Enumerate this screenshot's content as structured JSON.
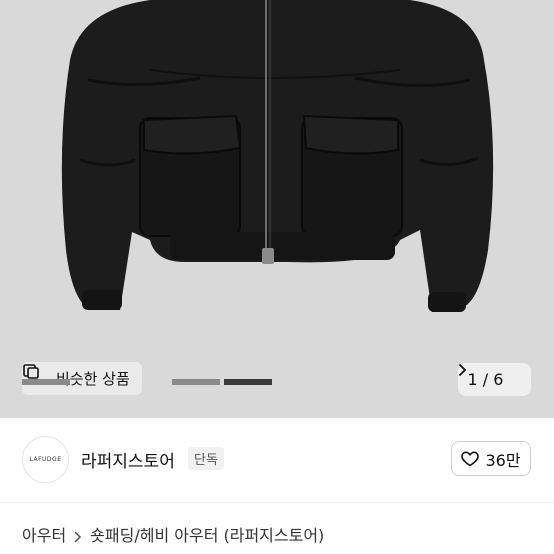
{
  "hero": {
    "image_alt": "black puffer jacket",
    "similar_label": "비슷한 상품",
    "similar_icon": "similar-items-icon",
    "pager_text": "1 / 6",
    "pager_icon": "chevron-right-icon"
  },
  "store": {
    "logo_text": "LAFUDGE",
    "name": "라퍼지스토어",
    "badge": "단독",
    "like_count": "36만",
    "like_icon": "heart-icon"
  },
  "breadcrumb": {
    "items": [
      "아우터",
      "숏패딩/헤비 아우터 (라퍼지스토어)"
    ],
    "separator_icon": "chevron-right-icon"
  },
  "colors": {
    "hero_bg": "#d9d9d9",
    "jacket": "#1b1b1b",
    "text": "#111111",
    "muted": "#555555"
  }
}
